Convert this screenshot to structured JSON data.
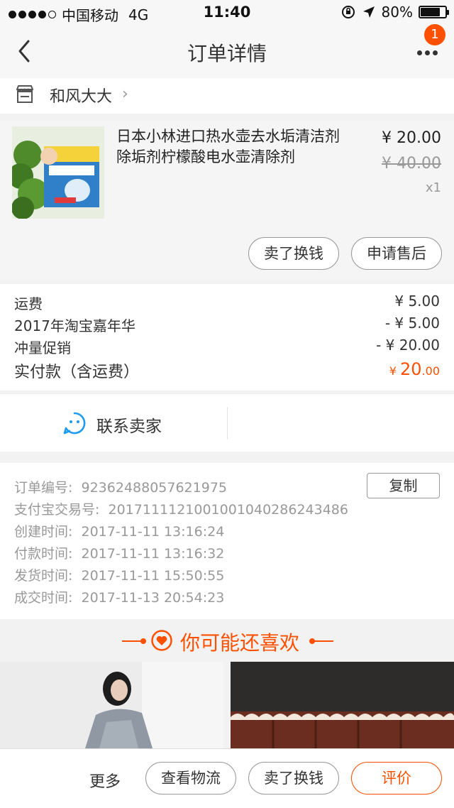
{
  "status_bar": {
    "carrier": "中国移动",
    "network": "4G",
    "time": "11:40",
    "battery": "80%",
    "battery_level": 0.8
  },
  "nav": {
    "title": "订单详情",
    "badge": "1"
  },
  "shop": {
    "name": "和风大大"
  },
  "product": {
    "title": "日本小林进口热水壶去水垢清洁剂除垢剂柠檬酸电水壶清除剂",
    "price": "¥ 20.00",
    "original_price": "¥ 40.00",
    "quantity": "x1",
    "sell_button": "卖了换钱",
    "after_sale_button": "申请售后"
  },
  "fees": [
    {
      "label": "运费",
      "value": "¥ 5.00"
    },
    {
      "label": "2017年淘宝嘉年华",
      "value": "- ¥ 5.00"
    },
    {
      "label": "冲量促销",
      "value": "- ¥ 20.00"
    }
  ],
  "total": {
    "label": "实付款（含运费）",
    "currency": "¥ ",
    "integer": "20",
    "decimal": ".00"
  },
  "contact": {
    "label": "联系卖家"
  },
  "order_info": {
    "copy_button": "复制",
    "rows": [
      {
        "label": "订单编号:",
        "value": "92362488057621975"
      },
      {
        "label": "支付宝交易号:",
        "value": "2017111121001001040286243486"
      },
      {
        "label": "创建时间:",
        "value": "2017-11-11 13:16:24"
      },
      {
        "label": "付款时间:",
        "value": "2017-11-11 13:16:32"
      },
      {
        "label": "发货时间:",
        "value": "2017-11-11 15:50:55"
      },
      {
        "label": "成交时间:",
        "value": "2017-11-13 20:54:23"
      }
    ]
  },
  "recommend": {
    "title": "你可能还喜欢"
  },
  "bottom_bar": {
    "more": "更多",
    "logistics": "查看物流",
    "sell": "卖了换钱",
    "review": "评价"
  },
  "colors": {
    "accent": "#ff5000",
    "contact_icon": "#1e9bf0"
  }
}
